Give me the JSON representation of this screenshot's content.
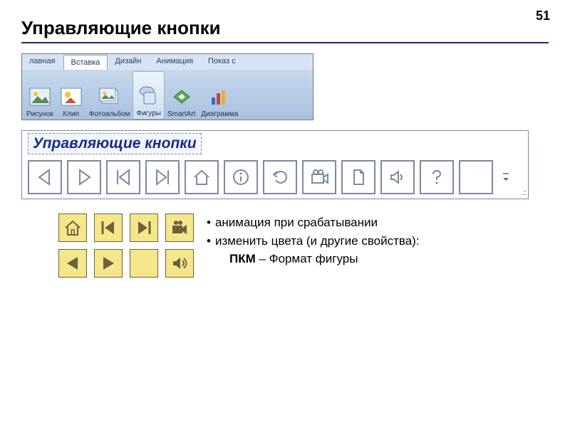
{
  "page_number": "51",
  "title": "Управляющие кнопки",
  "ribbon": {
    "tabs": [
      "лавная",
      "Вставка",
      "Дизайн",
      "Анимация",
      "Показ с"
    ],
    "active_index": 1,
    "buttons": [
      {
        "label": "Рисунок",
        "icon": "picture-icon"
      },
      {
        "label": "Клип",
        "icon": "clip-icon"
      },
      {
        "label": "Фотоальбом",
        "icon": "photo-album-icon"
      },
      {
        "label": "Фигуры",
        "icon": "shapes-icon",
        "selected": true
      },
      {
        "label": "SmartArt",
        "icon": "smartart-icon"
      },
      {
        "label": "Диаграмма",
        "icon": "chart-icon"
      }
    ]
  },
  "panel": {
    "title": "Управляющие кнопки",
    "buttons": [
      "back-icon",
      "forward-icon",
      "begin-icon",
      "end-icon",
      "home-icon",
      "info-icon",
      "return-icon",
      "movie-icon",
      "document-icon",
      "sound-icon",
      "help-icon",
      "custom-icon"
    ]
  },
  "yellow_buttons": [
    "home-icon",
    "begin-icon",
    "end-icon",
    "movie-icon",
    "back-icon",
    "forward-icon",
    "blank-icon",
    "sound-icon"
  ],
  "notes": {
    "line1": "анимация при срабатывании",
    "line2": "изменить цвета (и другие свойства):",
    "line3_bold": "ПКМ",
    "line3_rest": " – Формат фигуры"
  }
}
